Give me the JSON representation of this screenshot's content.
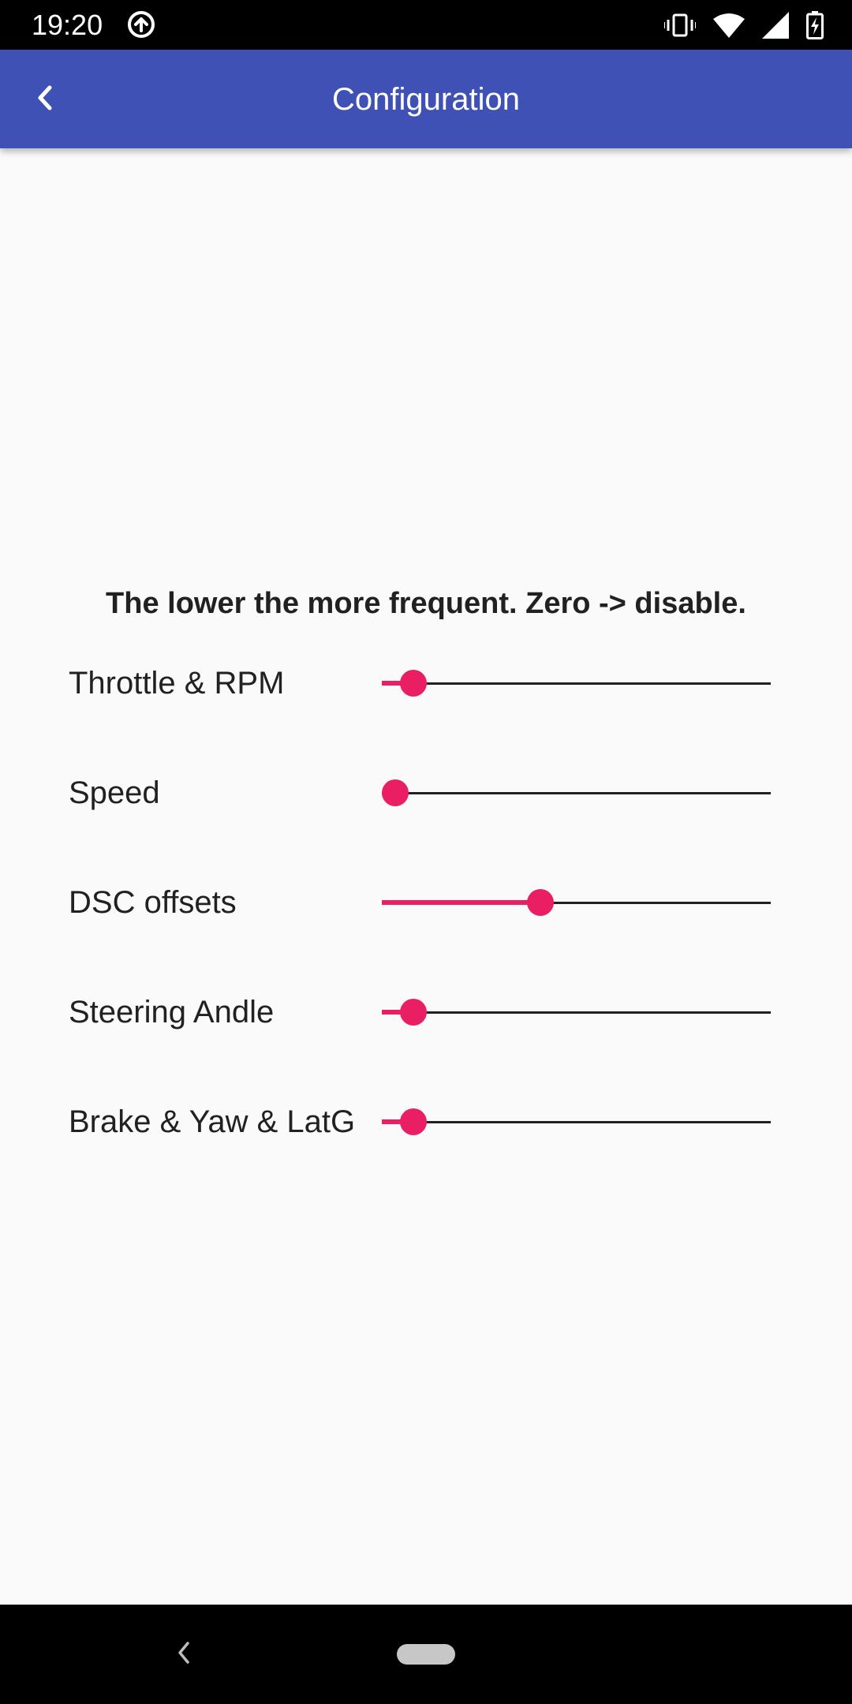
{
  "status_bar": {
    "time": "19:20",
    "left_icon": "data-saver-icon",
    "right_icons": [
      "vibrate-icon",
      "wifi-icon",
      "signal-icon",
      "battery-charging-icon"
    ]
  },
  "app_bar": {
    "title": "Configuration",
    "back_icon": "chevron-left-icon",
    "color": "#3f51b5"
  },
  "content": {
    "hint": "The lower the more frequent. Zero -> disable.",
    "accent_color": "#e91e63",
    "sliders": [
      {
        "label": "Throttle & RPM",
        "value": 0.05
      },
      {
        "label": "Speed",
        "value": 0.0
      },
      {
        "label": "DSC offsets",
        "value": 0.4
      },
      {
        "label": "Steering Andle",
        "value": 0.05
      },
      {
        "label": "Brake & Yaw & LatG",
        "value": 0.05
      }
    ]
  },
  "nav_bar": {
    "back_icon": "nav-back-icon",
    "home_icon": "home-pill-icon"
  }
}
